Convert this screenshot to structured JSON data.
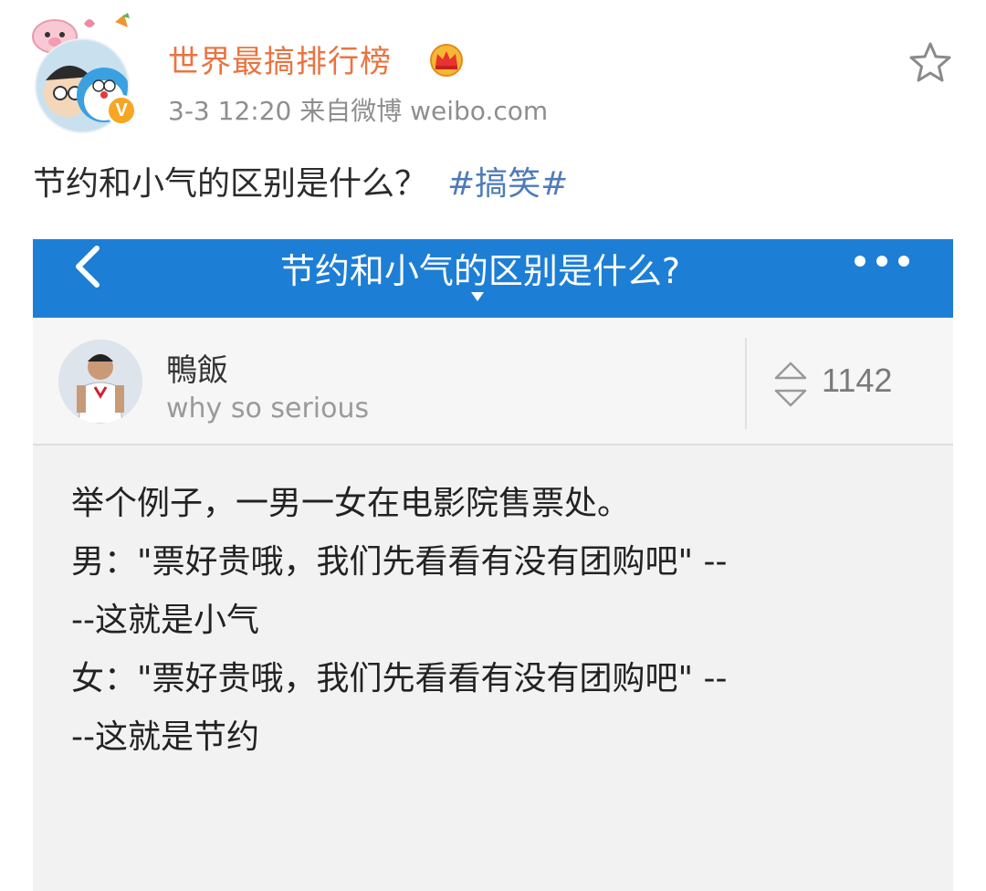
{
  "post": {
    "username": "世界最搞排行榜",
    "meta": "3-3 12:20  来自微博 weibo.com",
    "text": "节约和小气的区别是什么？",
    "hashtag": "#搞笑#"
  },
  "shot": {
    "nav_title": "节约和小气的区别是什么?",
    "answerer_name": "鴨飯",
    "answerer_bio": "why so serious",
    "vote_count": "1142",
    "answer_lines": [
      "举个例子，一男一女在电影院售票处。",
      "男：\"票好贵哦，我们先看看有没有团购吧\" --",
      "--这就是小气",
      "女：\"票好贵哦，我们先看看有没有团购吧\" --",
      "--这就是节约"
    ]
  },
  "colors": {
    "username": "#eb7340",
    "hashtag": "#4e7bb8",
    "nav_bar": "#1d7ed6",
    "verified": "#f5a623"
  },
  "icons": [
    "crown-icon",
    "star-icon",
    "back-icon",
    "more-icon",
    "vote-icon",
    "verified-icon"
  ]
}
